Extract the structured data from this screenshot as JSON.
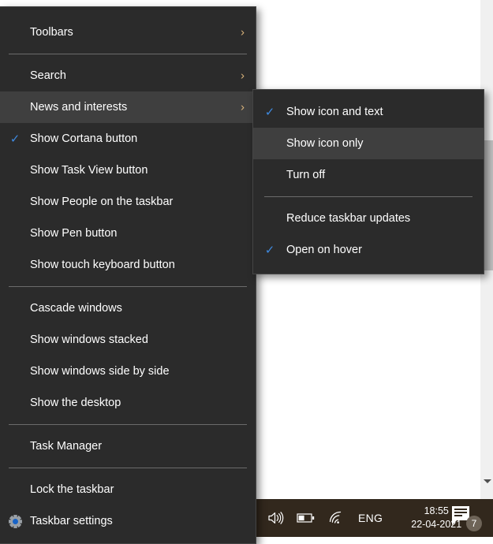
{
  "main_menu": {
    "name": "taskbar-context-menu",
    "groups": [
      {
        "items": [
          {
            "label": "Toolbars",
            "checked": false,
            "submenu": true,
            "highlighted": false,
            "icon": null
          }
        ]
      },
      {
        "items": [
          {
            "label": "Search",
            "checked": false,
            "submenu": true,
            "highlighted": false,
            "icon": null
          },
          {
            "label": "News and interests",
            "checked": false,
            "submenu": true,
            "highlighted": true,
            "icon": null
          },
          {
            "label": "Show Cortana button",
            "checked": true,
            "submenu": false,
            "highlighted": false,
            "icon": null
          },
          {
            "label": "Show Task View button",
            "checked": false,
            "submenu": false,
            "highlighted": false,
            "icon": null
          },
          {
            "label": "Show People on the taskbar",
            "checked": false,
            "submenu": false,
            "highlighted": false,
            "icon": null
          },
          {
            "label": "Show Pen button",
            "checked": false,
            "submenu": false,
            "highlighted": false,
            "icon": null
          },
          {
            "label": "Show touch keyboard button",
            "checked": false,
            "submenu": false,
            "highlighted": false,
            "icon": null
          }
        ]
      },
      {
        "items": [
          {
            "label": "Cascade windows",
            "checked": false,
            "submenu": false,
            "highlighted": false,
            "icon": null
          },
          {
            "label": "Show windows stacked",
            "checked": false,
            "submenu": false,
            "highlighted": false,
            "icon": null
          },
          {
            "label": "Show windows side by side",
            "checked": false,
            "submenu": false,
            "highlighted": false,
            "icon": null
          },
          {
            "label": "Show the desktop",
            "checked": false,
            "submenu": false,
            "highlighted": false,
            "icon": null
          }
        ]
      },
      {
        "items": [
          {
            "label": "Task Manager",
            "checked": false,
            "submenu": false,
            "highlighted": false,
            "icon": null
          }
        ]
      },
      {
        "items": [
          {
            "label": "Lock the taskbar",
            "checked": false,
            "submenu": false,
            "highlighted": false,
            "icon": null
          },
          {
            "label": "Taskbar settings",
            "checked": false,
            "submenu": false,
            "highlighted": false,
            "icon": "gear-icon"
          }
        ]
      }
    ]
  },
  "sub_menu": {
    "name": "news-and-interests-submenu",
    "groups": [
      {
        "items": [
          {
            "label": "Show icon and text",
            "checked": true,
            "highlighted": false
          },
          {
            "label": "Show icon only",
            "checked": false,
            "highlighted": true
          },
          {
            "label": "Turn off",
            "checked": false,
            "highlighted": false
          }
        ]
      },
      {
        "items": [
          {
            "label": "Reduce taskbar updates",
            "checked": false,
            "highlighted": false
          },
          {
            "label": "Open on hover",
            "checked": true,
            "highlighted": false
          }
        ]
      }
    ]
  },
  "taskbar": {
    "tray": {
      "volume_icon": "speaker-icon",
      "battery_icon": "battery-icon",
      "network_icon": "wifi-icon",
      "language": "ENG"
    },
    "clock": {
      "time": "18:55",
      "date": "22-04-2021"
    },
    "notifications": {
      "icon": "action-center-icon",
      "badge_count": "7"
    }
  },
  "scrollbar": {
    "name": "window-vertical-scrollbar",
    "arrow_down": "chevron-down-icon"
  },
  "colors": {
    "menu_bg": "#2b2b2b",
    "menu_highlight": "#3f3f3f",
    "menu_border": "#454545",
    "menu_text": "#ffffff",
    "separator": "#6b6b6b",
    "checkmark": "#3f8ae0",
    "chevron": "#d8b27a",
    "taskbar_bg": "#32281d",
    "gear_body": "#9aa0a6",
    "gear_hub": "#1763c7",
    "scrollbar_track": "#f0f0f0",
    "scrollbar_thumb": "#c1c1c1"
  },
  "glyphs": {
    "check": "✓",
    "chevron_right": "›"
  }
}
